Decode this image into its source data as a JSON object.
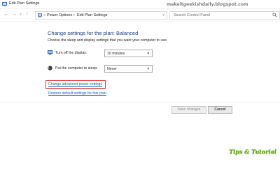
{
  "window": {
    "title": "Edit Plan Settings",
    "watermark": "makeitgeekishdaily.blogspot.com"
  },
  "nav": {
    "back_icon": "arrow-left-icon",
    "forward_icon": "arrow-right-icon",
    "up_icon": "arrow-up-icon",
    "breadcrumb": [
      "Power Options",
      "Edit Plan Settings"
    ],
    "breadcrumb_sep": ">",
    "search_placeholder": "Search Control Panel"
  },
  "main": {
    "heading": "Change settings for the plan: Balanced",
    "subtext": "Choose the sleep and display settings that you want your computer to use.",
    "settings": [
      {
        "label": "Turn off the display:",
        "value": "10 minutes",
        "icon": "monitor-icon"
      },
      {
        "label": "Put the computer to sleep:",
        "value": "Never",
        "icon": "moon-icon"
      }
    ],
    "links": {
      "advanced": "Change advanced power settings",
      "restore": "Restore default settings for this plan"
    }
  },
  "buttons": {
    "save": "Save changes",
    "cancel": "Cancel"
  },
  "logo_text": "Tips & Tutorial",
  "colors": {
    "heading": "#1e3f87",
    "link": "#1a5fb4",
    "highlight": "#e23030",
    "logo": "#7dbb2c"
  }
}
